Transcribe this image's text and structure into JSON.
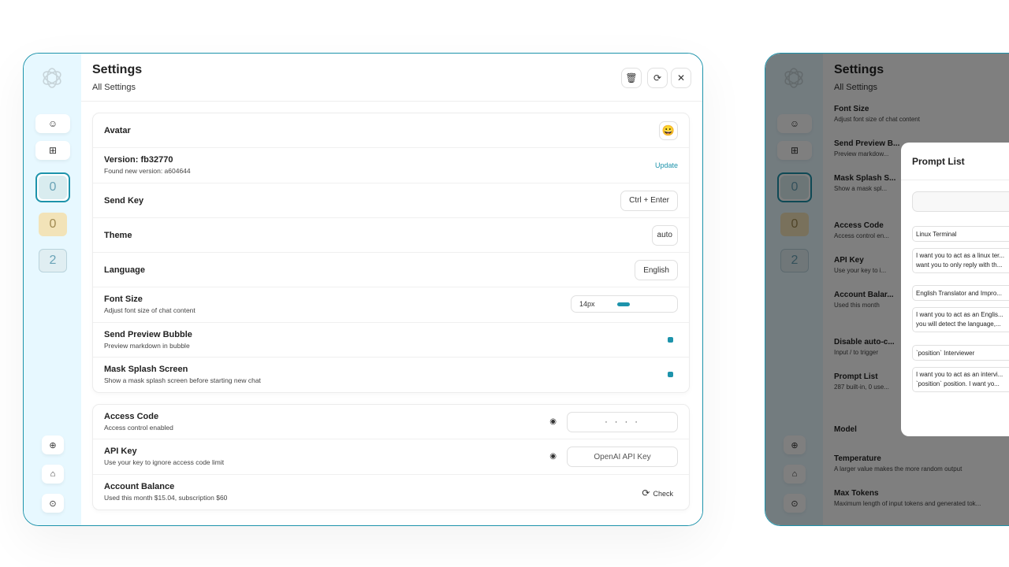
{
  "settings": {
    "title": "Settings",
    "subtitle": "All Settings",
    "header_buttons": {
      "clear": "🗑",
      "reset": "⟳",
      "close": "✕"
    }
  },
  "sidebar": {
    "buttons": {
      "mask": "☺",
      "discovery": "⊞"
    },
    "masks": [
      "0",
      "0",
      "2"
    ],
    "bottom": {
      "add": "⊕",
      "github": "⌂",
      "settings": "⊙"
    }
  },
  "group1": {
    "avatar": {
      "title": "Avatar",
      "emoji": "😀"
    },
    "version": {
      "title": "Version: fb32770",
      "sub": "Found new version: a604644",
      "action": "Update"
    },
    "send_key": {
      "title": "Send Key",
      "value": "Ctrl + Enter"
    },
    "theme": {
      "title": "Theme",
      "value": "auto"
    },
    "language": {
      "title": "Language",
      "value": "English"
    },
    "font_size": {
      "title": "Font Size",
      "sub": "Adjust font size of chat content",
      "value": "14px"
    },
    "preview_bubble": {
      "title": "Send Preview Bubble",
      "sub": "Preview markdown in bubble"
    },
    "mask_splash": {
      "title": "Mask Splash Screen",
      "sub": "Show a mask splash screen before starting new chat"
    }
  },
  "group2": {
    "access_code": {
      "title": "Access Code",
      "sub": "Access control enabled",
      "value": "· · · ·"
    },
    "api_key": {
      "title": "API Key",
      "sub": "Use your key to ignore access code limit",
      "placeholder": "OpenAI API Key"
    },
    "balance": {
      "title": "Account Balance",
      "sub": "Used this month $15.04, subscription $60",
      "action": "Check",
      "action_icon": "⟳"
    }
  },
  "right": {
    "title": "Settings",
    "subtitle": "All Settings",
    "rows": [
      {
        "t": "Font Size",
        "s": "Adjust font size of chat content"
      },
      {
        "t": "Send Preview B...",
        "s": "Preview markdow..."
      },
      {
        "t": "Mask Splash S...",
        "s": "Show a mask spl..."
      },
      {
        "t": "Access Code",
        "s": "Access control en..."
      },
      {
        "t": "API Key",
        "s": "Use your key to i..."
      },
      {
        "t": "Account Balar...",
        "s": "Used this month"
      },
      {
        "t": "Disable auto-c...",
        "s": "Input / to trigger"
      },
      {
        "t": "Prompt List",
        "s": "287 built-in, 0 use..."
      },
      {
        "t": "Model",
        "s": ""
      },
      {
        "t": "Temperature",
        "s": "A larger value makes the more random output"
      },
      {
        "t": "Max Tokens",
        "s": "Maximum length of input tokens and generated tok..."
      }
    ],
    "modal": {
      "title": "Prompt List",
      "prompts": [
        {
          "name": "Linux Terminal",
          "desc1": "I want you to act as a linux ter...",
          "desc2": "want you to only reply with th..."
        },
        {
          "name": "English Translator and Impro...",
          "desc1": "I want you to act as an Englis...",
          "desc2": "you will detect the language,..."
        },
        {
          "name": "`position` Interviewer",
          "desc1": "I want you to act as an intervi...",
          "desc2": "`position` position. I want yo..."
        }
      ]
    }
  },
  "colors": {
    "accent": "#1d93ab",
    "sidebar_bg": "#e7f8ff"
  }
}
